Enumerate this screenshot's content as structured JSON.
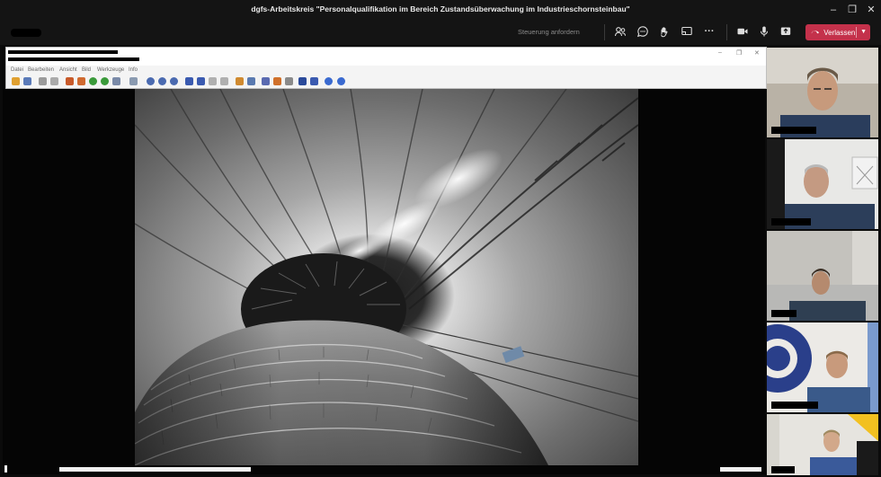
{
  "window": {
    "title": "dgfs-Arbeitskreis \"Personalqualifikation im Bereich Zustandsüberwachung im Industrieschornsteinbau\""
  },
  "toolbar": {
    "request_control_label": "Steuerung anfordern",
    "leave_label": "Verlassen",
    "icons": [
      "participants-icon",
      "chat-icon",
      "reactions-icon",
      "share-tray-icon",
      "more-icon",
      "camera-icon",
      "microphone-icon",
      "share-icon"
    ]
  },
  "viewer_app": {
    "menu": [
      "Datei",
      "Bearbeiten",
      "Ansicht",
      "Bild",
      "Werkzeuge",
      "Info"
    ]
  },
  "colors": {
    "leave_button": "#c4314b",
    "titlebar": "#141414"
  },
  "participants": [
    {
      "id": "p1"
    },
    {
      "id": "p2"
    },
    {
      "id": "p3"
    },
    {
      "id": "p4"
    },
    {
      "id": "p5"
    }
  ]
}
